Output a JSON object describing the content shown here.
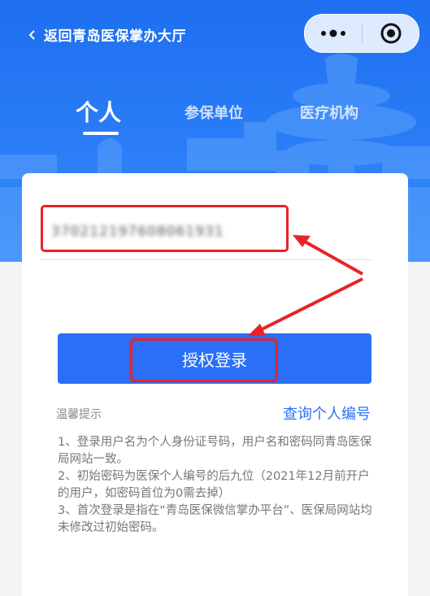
{
  "header": {
    "back_label": "返回青岛医保掌办大厅",
    "tabs": [
      {
        "label": "个人",
        "active": true
      },
      {
        "label": "参保单位",
        "active": false
      },
      {
        "label": "医疗机构",
        "active": false
      }
    ]
  },
  "form": {
    "id_value": "370212197608061931",
    "login_label": "授权登录"
  },
  "tips": {
    "title": "温馨提示",
    "query_link": "查询个人编号",
    "items": [
      "1、登录用户名为个人身份证号码，用户名和密码同青岛医保局网站一致。",
      "2、初始密码为医保个人编号的后九位（2021年12月前开户的用户，如密码首位为0需去掉）",
      "3、首次登录是指在“青岛医保微信掌办平台”、医保局网站均未修改过初始密码。"
    ]
  },
  "colors": {
    "header_blue": "#2a7df7",
    "primary": "#2a6ff6",
    "annotation_red": "#e8222a"
  },
  "icons": [
    "chevron-left-icon",
    "more-dots-icon",
    "target-close-icon"
  ]
}
